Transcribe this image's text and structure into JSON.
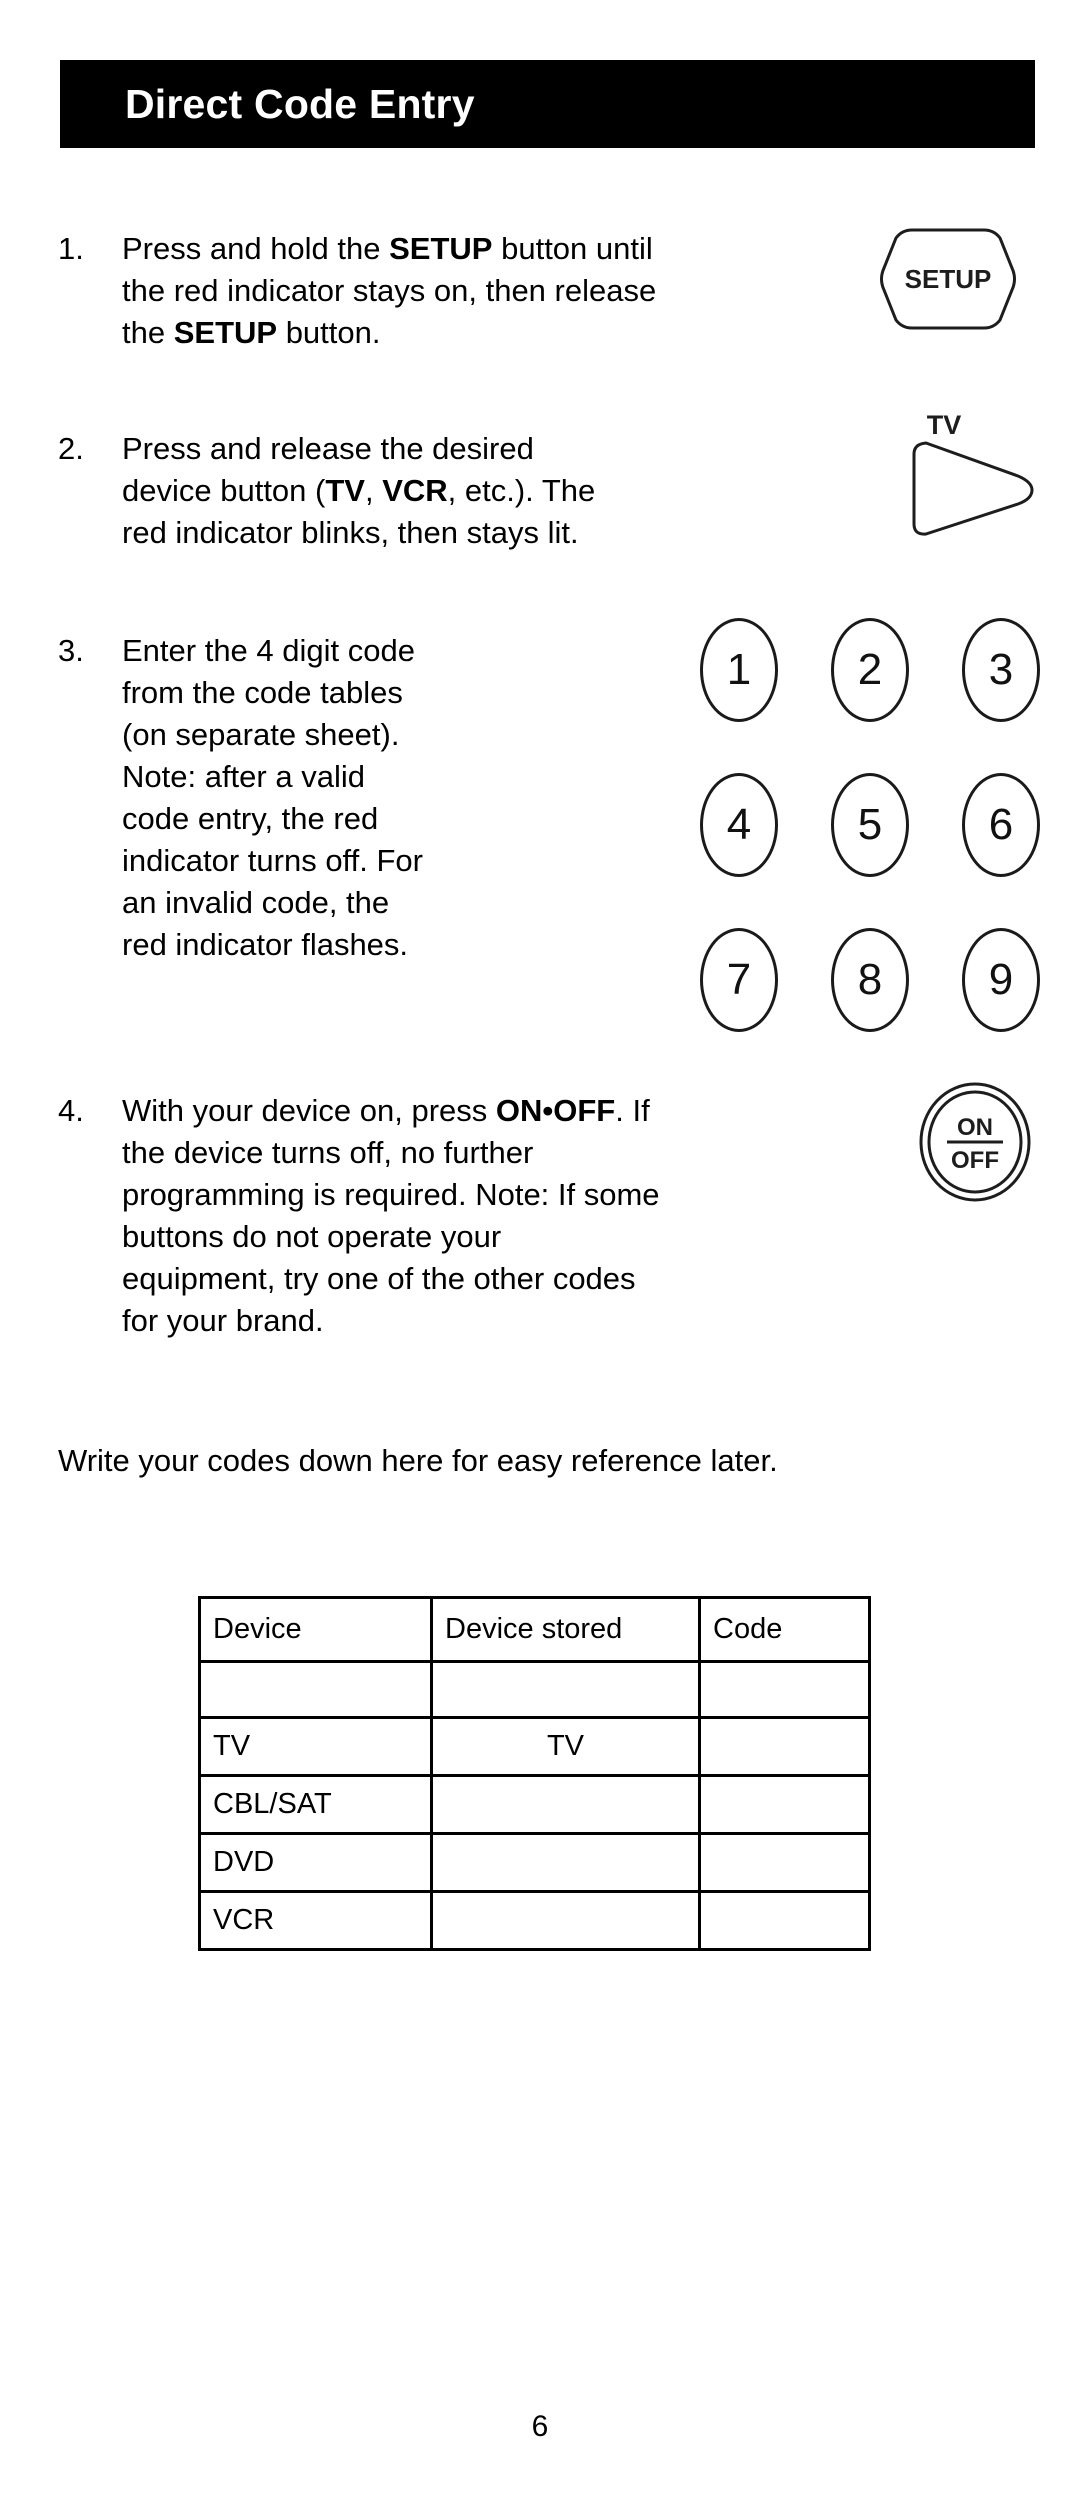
{
  "page": {
    "title": "Direct Code Entry",
    "number": "6"
  },
  "steps": [
    {
      "number": "1.",
      "text_parts": [
        {
          "t": "Press and hold the ",
          "b": false
        },
        {
          "t": "SETUP",
          "b": true
        },
        {
          "t": " button until the red indicator stays on, then release the ",
          "b": false
        },
        {
          "t": "SETUP",
          "b": true
        },
        {
          "t": " button.",
          "b": false
        }
      ]
    },
    {
      "number": "2.",
      "text_parts": [
        {
          "t": "Press and release the desired device button (",
          "b": false
        },
        {
          "t": "TV",
          "b": true
        },
        {
          "t": ", ",
          "b": false
        },
        {
          "t": "VCR",
          "b": true
        },
        {
          "t": ", etc.). The red indicator blinks, then stays lit.",
          "b": false
        }
      ]
    },
    {
      "number": "3.",
      "text_parts": [
        {
          "t": "Enter the 4 digit code from the code tables (on separate sheet). Note: after a valid code entry, the red indicator turns off.  For an invalid code, the red indicator flashes.",
          "b": false
        }
      ]
    },
    {
      "number": "4.",
      "text_parts": [
        {
          "t": "With your device on, press ",
          "b": false
        },
        {
          "t": "ON•OFF",
          "b": true
        },
        {
          "t": ". If the device turns off, no further programming is required. Note: If some buttons do not operate your equipment, try one of the other codes for your brand.",
          "b": false
        }
      ]
    }
  ],
  "write_note": "Write your codes down here for easy reference later.",
  "remote_buttons": {
    "setup": {
      "label": "SETUP"
    },
    "device": {
      "label": "TV"
    },
    "power": {
      "line1": "ON",
      "line2": "OFF"
    }
  },
  "keypad": {
    "keys": [
      "1",
      "2",
      "3",
      "4",
      "5",
      "6",
      "7",
      "8",
      "9"
    ]
  },
  "table": {
    "headers": [
      "Device",
      "Device stored",
      "Code"
    ],
    "rows": [
      [
        "",
        "",
        ""
      ],
      [
        "TV",
        "TV",
        ""
      ],
      [
        "CBL/SAT",
        "",
        ""
      ],
      [
        "DVD",
        "",
        ""
      ],
      [
        "VCR",
        "",
        ""
      ]
    ]
  },
  "colors": {
    "banner_background": "#000000",
    "banner_text": "#ffffff",
    "ink": "#000000",
    "paper": "#ffffff"
  }
}
